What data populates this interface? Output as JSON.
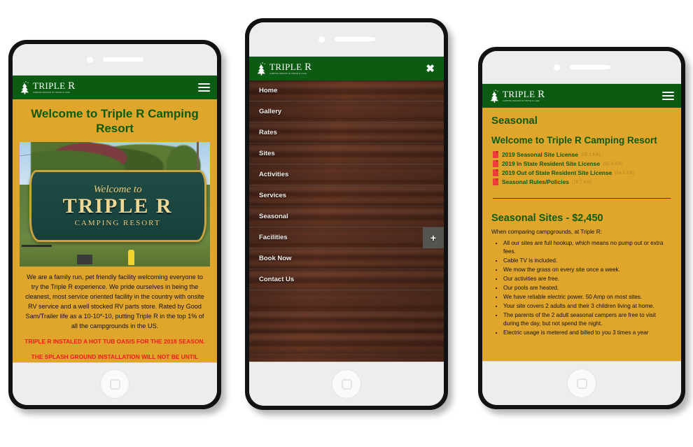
{
  "brand": {
    "name_main": "TRIPLE",
    "name_accent": "R",
    "tagline": "CAMPING RESORT IN TRIPLE R LAKE"
  },
  "icons": {
    "hamburger": "hamburger-menu-icon",
    "close": "✖",
    "plus": "+",
    "pine_tree": "pine-tree-icon"
  },
  "phone1": {
    "hero_title": "Welcome to Triple R Camping Resort",
    "photo": {
      "sign_welcome": "Welcome to",
      "sign_name": "TRIPLE R",
      "sign_sub": "CAMPING RESORT"
    },
    "paragraph": "We are a family run, pet friendly facility welcoming everyone to try the Triple R experience. We pride ourselves in being the cleanest, most service oriented facility in the country with onsite RV service and a well stocked RV parts store. Rated by Good Sam/Trailer life as a 10-10*-10, putting Triple R in the top 1% of all the campgrounds in the US.",
    "alert1": "TRIPLE R INSTALED A HOT TUB OASIS FOR THE 2018 SEASON.",
    "alert2": "THE SPLASH GROUND INSTALLATION WILL NOT BE UNTIL"
  },
  "phone2": {
    "menu": [
      {
        "label": "Home",
        "has_submenu": false
      },
      {
        "label": "Gallery",
        "has_submenu": false
      },
      {
        "label": "Rates",
        "has_submenu": false
      },
      {
        "label": "Sites",
        "has_submenu": false
      },
      {
        "label": "Activities",
        "has_submenu": false
      },
      {
        "label": "Services",
        "has_submenu": false
      },
      {
        "label": "Seasonal",
        "has_submenu": false
      },
      {
        "label": "Facilities",
        "has_submenu": true
      },
      {
        "label": "Book Now",
        "has_submenu": false
      },
      {
        "label": "Contact Us",
        "has_submenu": false
      }
    ]
  },
  "phone3": {
    "page_title": "Seasonal",
    "section_title": "Welcome to Triple R Camping Resort",
    "documents": [
      {
        "label": "2019 Seasonal Site License",
        "size": "(55.1 KB)"
      },
      {
        "label": "2019 In State Resident Site License",
        "size": "(55.2 KB)"
      },
      {
        "label": "2019 Out of State Resident Site License",
        "size": "(54.1 KB)"
      },
      {
        "label": "Seasonal Rules/Policies",
        "size": "(78.7 KB)"
      }
    ],
    "price_heading": "Seasonal Sites - $2,450",
    "lead": "When comparing campgrounds, at Triple R:",
    "bullets": [
      "All our sites are full hookup, which means no pump out or extra fees.",
      "Cable TV is included.",
      "We mow the grass on every site once a week.",
      "Our activities are free.",
      "Our pools are heated.",
      "We have reliable electric power. 50 Amp on most sites.",
      "Your site covers 2 adults and their 3 children living at home.",
      "The parents of the 2 adult seasonal campers are free to visit during the day, but not spend the night.",
      "Electric usage is metered and billed to you 3 times a year"
    ]
  },
  "colors": {
    "header_green": "#0b5c12",
    "background_gold": "#e0a52b",
    "alert_red": "#ee1c1c",
    "wood_brown": "#5a3020",
    "pdf_red": "#ef3b3b"
  }
}
